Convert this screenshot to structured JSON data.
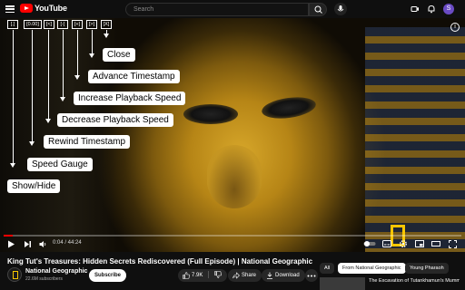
{
  "header": {
    "logo_text": "YouTube",
    "search_placeholder": "Search",
    "avatar_letter": "S",
    "icons": [
      "menu-icon",
      "search-icon",
      "mic-icon",
      "create-icon",
      "notifications-icon"
    ]
  },
  "overlay": {
    "buttons": [
      {
        "label": "[.]",
        "name": "show-hide-toggle"
      },
      {
        "label": "[0.00]",
        "name": "speed-gauge-display"
      },
      {
        "label": "[<]",
        "name": "rewind-button"
      },
      {
        "label": "[-]",
        "name": "decrease-speed-button"
      },
      {
        "label": "[+]",
        "name": "increase-speed-button"
      },
      {
        "label": "[>]",
        "name": "advance-button"
      },
      {
        "label": "[X]",
        "name": "close-button"
      }
    ],
    "labels": {
      "close": "Close",
      "advance": "Advance Timestamp",
      "increase": "Increase Playback Speed",
      "decrease": "Decrease Playback Speed",
      "rewind": "Rewind Timestamp",
      "speed": "Speed Gauge",
      "show_hide": "Show/Hide"
    }
  },
  "player": {
    "time": "0:04 / 44:24",
    "progress": 0.0015
  },
  "video_info": {
    "title": "King Tut's Treasures: Hidden Secrets Rediscovered (Full Episode) | National Geographic",
    "channel": "National Geographic",
    "subscribers": "22.6M subscribers",
    "subscribe_label": "Subscribe",
    "likes": "7.9K",
    "share_label": "Share",
    "download_label": "Download"
  },
  "sidebar": {
    "chips": [
      "All",
      "From National Geographic",
      "Young Pharaoh"
    ],
    "recommendation": "The Excavation of Tutankhamun's Mummy | King"
  }
}
